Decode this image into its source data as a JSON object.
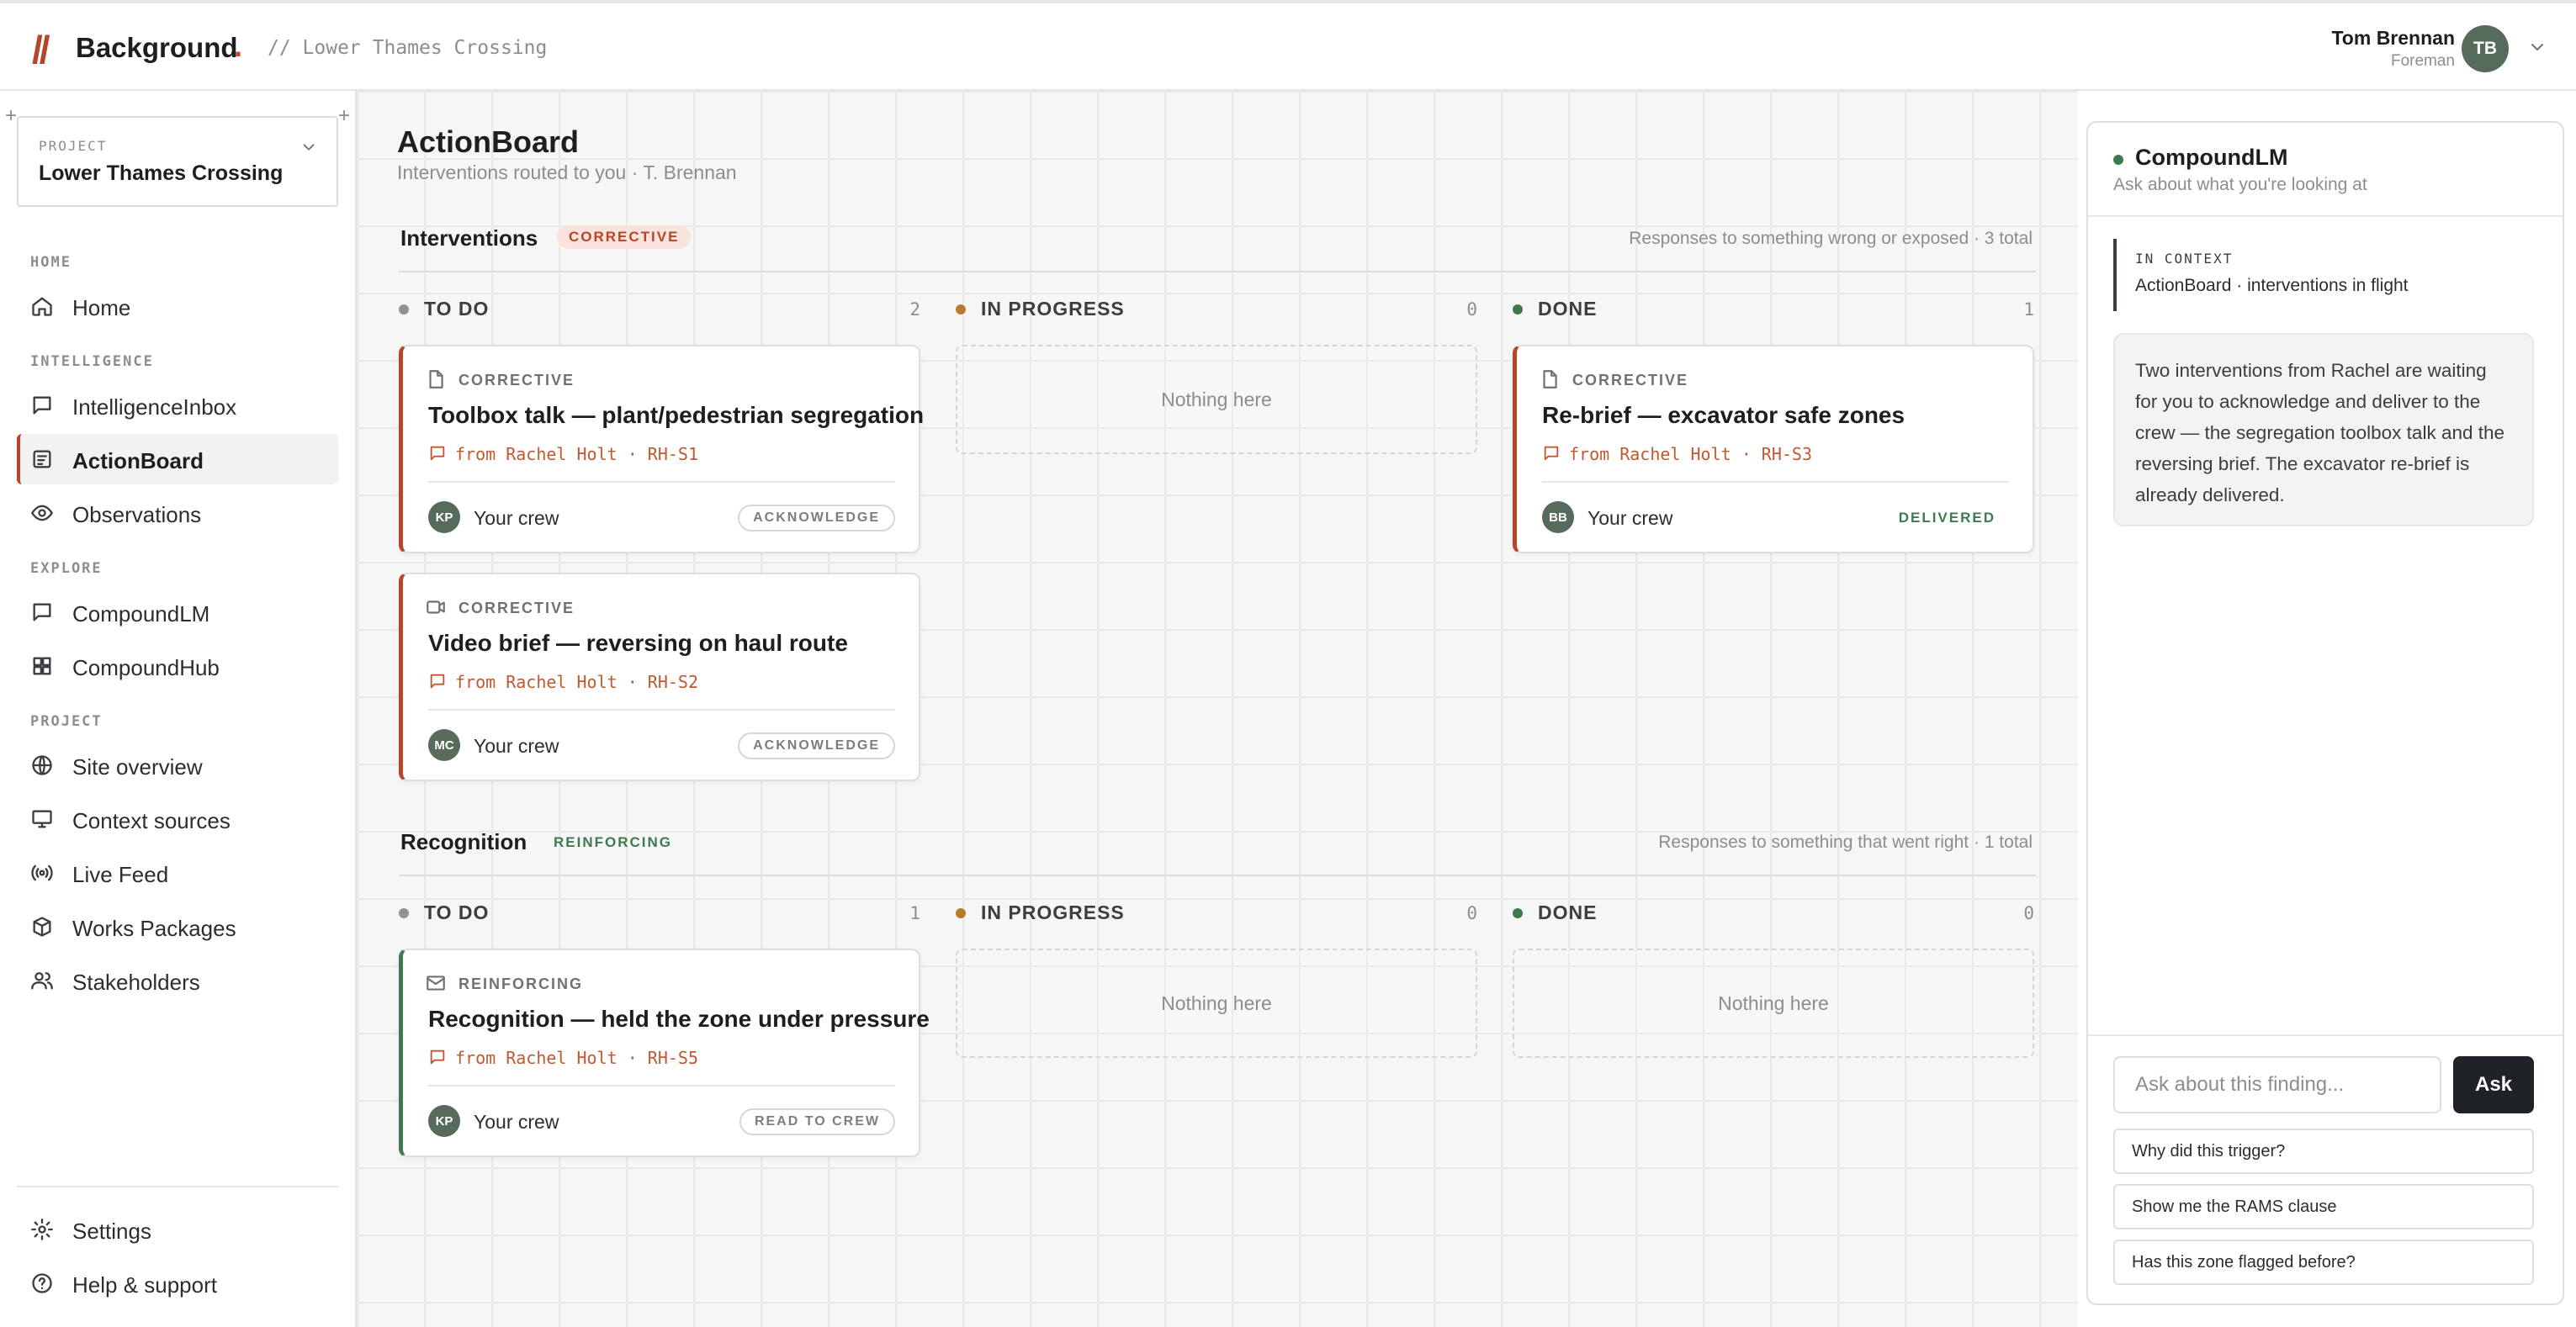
{
  "header": {
    "logo_mark": "//",
    "brand": "Background",
    "brand_dot": ".",
    "breadcrumb": "// Lower Thames Crossing",
    "user": {
      "name": "Tom Brennan",
      "role": "Foreman",
      "initials": "TB"
    }
  },
  "sidebar": {
    "project": {
      "kicker": "PROJECT",
      "name": "Lower Thames Crossing"
    },
    "sections": {
      "home": "HOME",
      "intelligence": "INTELLIGENCE",
      "explore": "EXPLORE",
      "project": "PROJECT"
    },
    "items": [
      {
        "label": "Home",
        "icon": "home-icon"
      },
      {
        "label": "IntelligenceInbox",
        "icon": "inbox-icon"
      },
      {
        "label": "ActionBoard",
        "icon": "board-icon",
        "active": true
      },
      {
        "label": "Observations",
        "icon": "eye-icon"
      },
      {
        "label": "CompoundLM",
        "icon": "chat-icon"
      },
      {
        "label": "CompoundHub",
        "icon": "grid-icon"
      },
      {
        "label": "Site overview",
        "icon": "globe-icon"
      },
      {
        "label": "Context sources",
        "icon": "monitor-icon"
      },
      {
        "label": "Live Feed",
        "icon": "broadcast-icon"
      },
      {
        "label": "Works Packages",
        "icon": "package-icon"
      },
      {
        "label": "Stakeholders",
        "icon": "users-icon"
      }
    ],
    "footer": [
      {
        "label": "Settings",
        "icon": "gear-icon"
      },
      {
        "label": "Help & support",
        "icon": "help-icon"
      }
    ]
  },
  "main": {
    "title": "ActionBoard",
    "subtitle": "Interventions routed to you · T. Brennan",
    "columns_labels": {
      "todo": "TO DO",
      "progress": "IN PROGRESS",
      "done": "DONE"
    },
    "empty_text": "Nothing here",
    "interventions": {
      "title": "Interventions",
      "badge": "CORRECTIVE",
      "meta": "Responses to something wrong or exposed · 3 total",
      "counts": {
        "todo": "2",
        "progress": "0",
        "done": "1"
      },
      "cards": [
        {
          "kind": "CORRECTIVE",
          "title": "Toolbox talk — plant/pedestrian segregation",
          "from": "from Rachel Holt · RH-S1",
          "initials": "KP",
          "crew": "Your crew",
          "action": "ACKNOWLEDGE"
        },
        {
          "kind": "CORRECTIVE",
          "title": "Video brief — reversing on haul route",
          "from": "from Rachel Holt · RH-S2",
          "initials": "MC",
          "crew": "Your crew",
          "action": "ACKNOWLEDGE"
        },
        {
          "kind": "CORRECTIVE",
          "title": "Re-brief — excavator safe zones",
          "from": "from Rachel Holt · RH-S3",
          "initials": "BB",
          "crew": "Your crew",
          "status": "DELIVERED"
        }
      ]
    },
    "recognition": {
      "title": "Recognition",
      "badge": "REINFORCING",
      "meta": "Responses to something that went right · 1 total",
      "counts": {
        "todo": "1",
        "progress": "0",
        "done": "0"
      },
      "cards": [
        {
          "kind": "REINFORCING",
          "title": "Recognition — held the zone under pressure",
          "from": "from Rachel Holt · RH-S5",
          "initials": "KP",
          "crew": "Your crew",
          "action": "READ TO CREW"
        }
      ]
    }
  },
  "chat": {
    "title": "CompoundLM",
    "subtitle": "Ask about what you're looking at",
    "context_kicker": "IN CONTEXT",
    "context_text": "ActionBoard · interventions in flight",
    "message": "Two interventions from Rachel are waiting for you to acknowledge and deliver to the crew — the segregation toolbox talk and the reversing brief. The excavator re-brief is already delivered.",
    "input_placeholder": "Ask about this finding...",
    "ask_label": "Ask",
    "suggestions": [
      "Why did this trigger?",
      "Show me the RAMS clause",
      "Has this zone flagged before?"
    ]
  },
  "colors": {
    "accent": "#b5462a",
    "reinforcing": "#3e7a4e",
    "todo_dot": "#8a939a",
    "progress_dot": "#b87a2e",
    "done_dot": "#3e7a4e"
  }
}
